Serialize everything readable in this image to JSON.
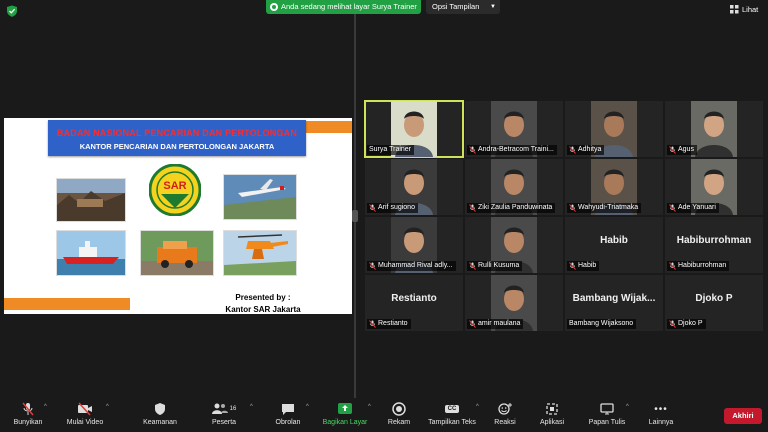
{
  "topbar": {
    "share_banner": "Anda sedang melihat layar Surya Trainer",
    "view_options": "Opsi Tampilan",
    "view_label": "Lihat"
  },
  "slide": {
    "title_line1": "BADAN NASIONAL PENCARIAN DAN PERTOLONGAN",
    "title_line2": "KANTOR PENCARIAN DAN PERTOLONGAN JAKARTA",
    "presented_by": "Presented by :",
    "presenter": "Kantor SAR Jakarta",
    "logo_text": "SAR"
  },
  "participants": [
    {
      "name": "Surya Trainer",
      "video": true,
      "active": true,
      "muted": false
    },
    {
      "name": "Andra-Betracom Traini...",
      "video": true,
      "muted": true
    },
    {
      "name": "Adhitya",
      "video": true,
      "muted": true
    },
    {
      "name": "Agus",
      "video": true,
      "muted": true
    },
    {
      "name": "Arif sugiono",
      "video": true,
      "muted": true
    },
    {
      "name": "Ziki Zaulia Panduwinata",
      "video": true,
      "muted": true
    },
    {
      "name": "Wahyudi-Triatmaka",
      "video": true,
      "muted": true
    },
    {
      "name": "Ade Yanuari",
      "video": true,
      "muted": true
    },
    {
      "name": "Muhammad Rival adly...",
      "video": true,
      "muted": true
    },
    {
      "name": "Rulli Kusuma",
      "video": true,
      "muted": true
    },
    {
      "name": "Habib",
      "video": false,
      "display": "Habib",
      "muted": true
    },
    {
      "name": "Habiburrohman",
      "video": false,
      "display": "Habiburrohman",
      "muted": true
    },
    {
      "name": "Restianto",
      "video": false,
      "display": "Restianto",
      "muted": true
    },
    {
      "name": "amir maulana",
      "video": true,
      "muted": true
    },
    {
      "name": "Bambang Wijaksono",
      "video": false,
      "display": "Bambang  Wijak...",
      "muted": false
    },
    {
      "name": "Djoko P",
      "video": false,
      "display": "Djoko P",
      "muted": true
    }
  ],
  "toolbar": {
    "unmute": "Bunyikan",
    "start_video": "Mulai Video",
    "security": "Keamanan",
    "participants": "Peserta",
    "participants_count": "16",
    "chat": "Obrolan",
    "share_screen": "Bagikan Layar",
    "record": "Rekam",
    "captions": "Tampilkan Teks",
    "captions_badge": "CC",
    "reactions": "Reaksi",
    "apps": "Aplikasi",
    "whiteboard": "Papan Tulis",
    "more": "Lainnya",
    "end": "Akhiri"
  },
  "colors": {
    "share_green": "#21a144",
    "end_red": "#c4182c",
    "active_outline": "#cfe25a",
    "slide_blue": "#2e62c9",
    "slide_orange": "#f08a24"
  }
}
